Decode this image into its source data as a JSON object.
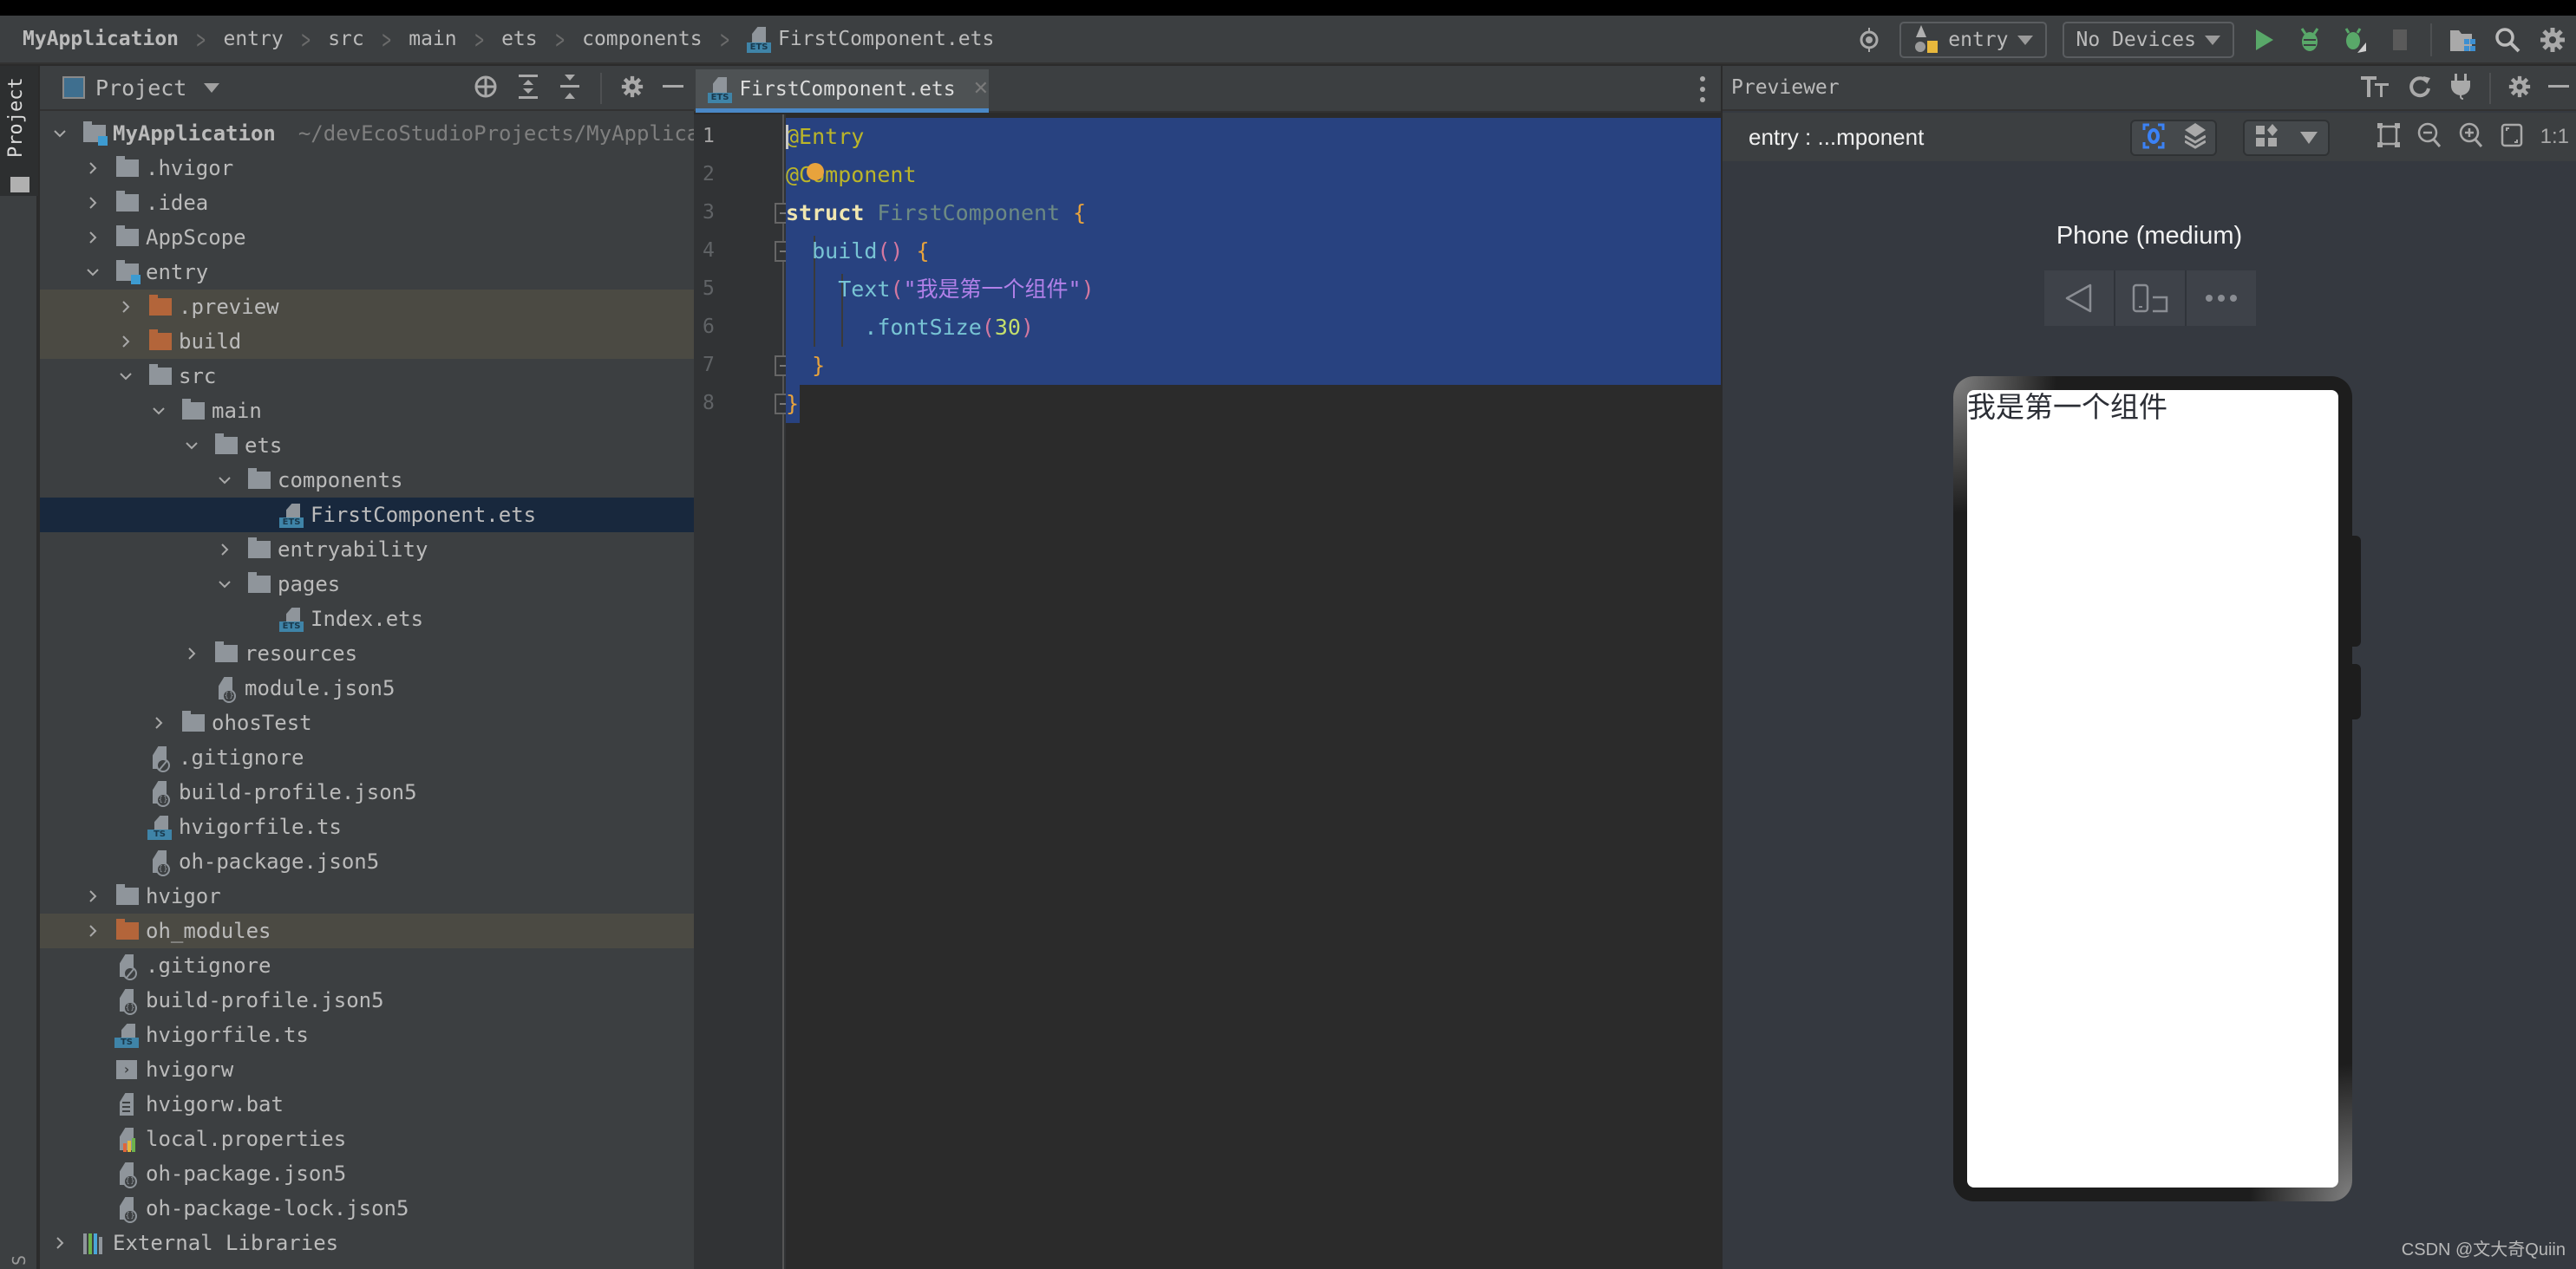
{
  "breadcrumb": {
    "items": [
      "MyApplication",
      "entry",
      "src",
      "main",
      "ets",
      "components"
    ],
    "file": "FirstComponent.ets",
    "file_badge": "ETS"
  },
  "toolbar": {
    "module_select": "entry",
    "device_select": "No Devices",
    "icons": [
      "locate-icon",
      "run-icon",
      "debug-icon",
      "attach-debugger-icon",
      "stop-icon",
      "project-structure-icon",
      "search-icon",
      "settings-icon"
    ]
  },
  "side_strip": {
    "project_tab": "Project",
    "bottom_tab_partial": "S"
  },
  "project_panel": {
    "title": "Project",
    "header_icons": [
      "locate-icon",
      "expand-all-icon",
      "collapse-all-icon",
      "settings-icon",
      "minimize-icon"
    ],
    "tree": [
      {
        "label": "MyApplication",
        "path": "~/devEcoStudioProjects/MyApplica",
        "depth": 0,
        "expanded": true,
        "icon": "module-folder",
        "bold": true
      },
      {
        "label": ".hvigor",
        "depth": 1,
        "expanded": false,
        "icon": "folder"
      },
      {
        "label": ".idea",
        "depth": 1,
        "expanded": false,
        "icon": "folder"
      },
      {
        "label": "AppScope",
        "depth": 1,
        "expanded": false,
        "icon": "folder"
      },
      {
        "label": "entry",
        "depth": 1,
        "expanded": true,
        "icon": "module-folder"
      },
      {
        "label": ".preview",
        "depth": 2,
        "expanded": false,
        "icon": "excluded-folder",
        "excluded": true
      },
      {
        "label": "build",
        "depth": 2,
        "expanded": false,
        "icon": "excluded-folder",
        "excluded": true
      },
      {
        "label": "src",
        "depth": 2,
        "expanded": true,
        "icon": "folder"
      },
      {
        "label": "main",
        "depth": 3,
        "expanded": true,
        "icon": "folder"
      },
      {
        "label": "ets",
        "depth": 4,
        "expanded": true,
        "icon": "folder"
      },
      {
        "label": "components",
        "depth": 5,
        "expanded": true,
        "icon": "folder"
      },
      {
        "label": "FirstComponent.ets",
        "depth": 6,
        "icon": "ets-file",
        "selected": true
      },
      {
        "label": "entryability",
        "depth": 5,
        "expanded": false,
        "icon": "folder"
      },
      {
        "label": "pages",
        "depth": 5,
        "expanded": true,
        "icon": "folder"
      },
      {
        "label": "Index.ets",
        "depth": 6,
        "icon": "ets-file"
      },
      {
        "label": "resources",
        "depth": 4,
        "expanded": false,
        "icon": "folder"
      },
      {
        "label": "module.json5",
        "depth": 4,
        "icon": "json-file"
      },
      {
        "label": "ohosTest",
        "depth": 3,
        "expanded": false,
        "icon": "folder"
      },
      {
        "label": ".gitignore",
        "depth": 2,
        "icon": "ignore-file"
      },
      {
        "label": "build-profile.json5",
        "depth": 2,
        "icon": "json-file"
      },
      {
        "label": "hvigorfile.ts",
        "depth": 2,
        "icon": "ts-file"
      },
      {
        "label": "oh-package.json5",
        "depth": 2,
        "icon": "json-file"
      },
      {
        "label": "hvigor",
        "depth": 1,
        "expanded": false,
        "icon": "folder"
      },
      {
        "label": "oh_modules",
        "depth": 1,
        "expanded": false,
        "icon": "excluded-folder",
        "excluded": true
      },
      {
        "label": ".gitignore",
        "depth": 1,
        "icon": "ignore-file"
      },
      {
        "label": "build-profile.json5",
        "depth": 1,
        "icon": "json-file"
      },
      {
        "label": "hvigorfile.ts",
        "depth": 1,
        "icon": "ts-file"
      },
      {
        "label": "hvigorw",
        "depth": 1,
        "icon": "shell-file"
      },
      {
        "label": "hvigorw.bat",
        "depth": 1,
        "icon": "text-file"
      },
      {
        "label": "local.properties",
        "depth": 1,
        "icon": "properties-file"
      },
      {
        "label": "oh-package.json5",
        "depth": 1,
        "icon": "json-file"
      },
      {
        "label": "oh-package-lock.json5",
        "depth": 1,
        "icon": "json-file"
      },
      {
        "label": "External Libraries",
        "depth": 0,
        "expanded": false,
        "icon": "libraries"
      }
    ]
  },
  "editor": {
    "tab_label": "FirstComponent.ets",
    "tab_badge": "ETS",
    "line_numbers": [
      "1",
      "2",
      "3",
      "4",
      "5",
      "6",
      "7",
      "8"
    ],
    "current_line": 1,
    "lines": [
      [
        {
          "t": "@Entry",
          "c": "ann"
        }
      ],
      [
        {
          "t": "@Component",
          "c": "ann"
        }
      ],
      [
        {
          "t": "struct",
          "c": "kw"
        },
        {
          "t": " "
        },
        {
          "t": "FirstComponent",
          "c": "type"
        },
        {
          "t": " "
        },
        {
          "t": "{",
          "c": "brace"
        }
      ],
      [
        {
          "t": "  "
        },
        {
          "t": "build",
          "c": "fn"
        },
        {
          "t": "()",
          "c": "paren"
        },
        {
          "t": " "
        },
        {
          "t": "{",
          "c": "brace"
        }
      ],
      [
        {
          "t": "    "
        },
        {
          "t": "Text",
          "c": "fn"
        },
        {
          "t": "(",
          "c": "paren"
        },
        {
          "t": "\"我是第一个组件\"",
          "c": "str"
        },
        {
          "t": ")",
          "c": "paren"
        }
      ],
      [
        {
          "t": "      "
        },
        {
          "t": ".fontSize",
          "c": "fn"
        },
        {
          "t": "(",
          "c": "paren"
        },
        {
          "t": "30",
          "c": "num"
        },
        {
          "t": ")",
          "c": "paren"
        }
      ],
      [
        {
          "t": "  "
        },
        {
          "t": "}",
          "c": "brace"
        }
      ],
      [
        {
          "t": "}",
          "c": "brace"
        }
      ]
    ],
    "status": "no-problems"
  },
  "previewer": {
    "title": "Previewer",
    "target": "entry : ...mponent",
    "zoom_label": "1:1",
    "device_name": "Phone (medium)",
    "device_controls": [
      "back-icon",
      "rotate-icon",
      "more-icon"
    ],
    "screen_text": "我是第一个组件"
  },
  "colors": {
    "selection": "#284280",
    "accent": "#4a88c7",
    "run_green": "#59a869",
    "ets_badge": "#3f84a8",
    "excluded_folder": "#b3653a"
  },
  "watermark": "CSDN @文大奇Quiin"
}
